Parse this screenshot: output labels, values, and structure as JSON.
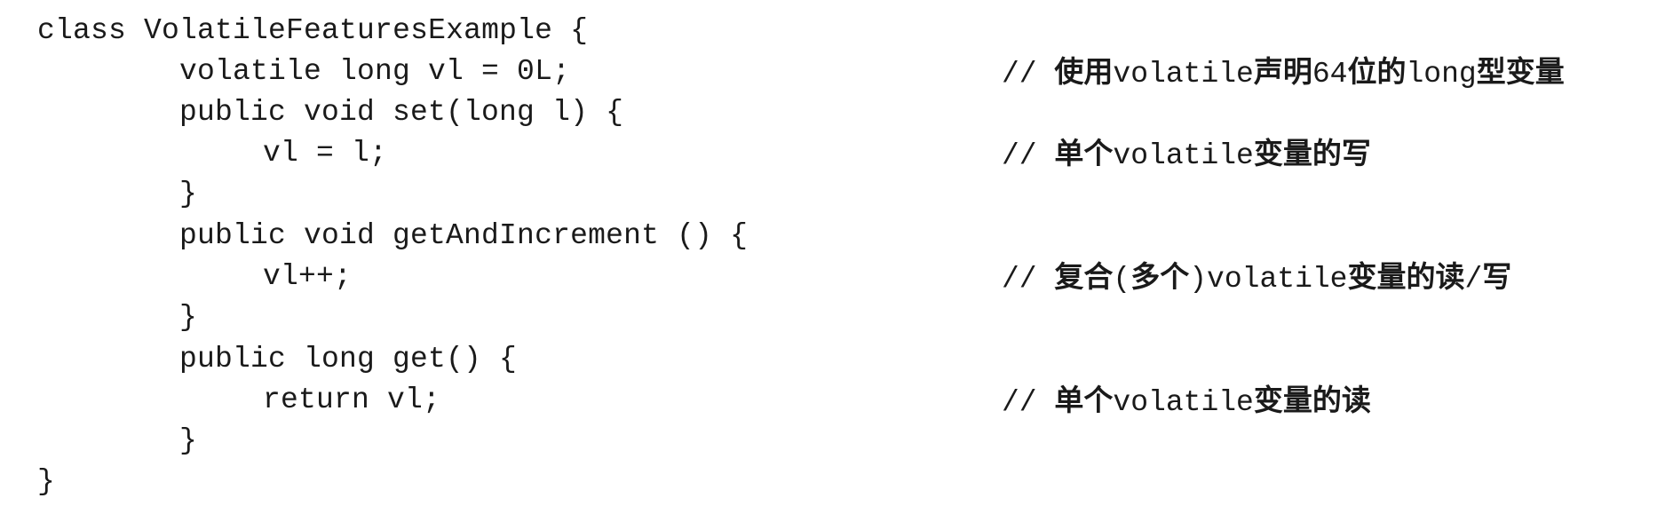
{
  "code": {
    "lines": [
      {
        "text": "class VolatileFeaturesExample {"
      },
      {
        "text": "volatile long vl = 0L;"
      },
      {
        "text": "public void set(long l) {"
      },
      {
        "text": "vl = l;"
      },
      {
        "text": "}"
      },
      {
        "text": "public void getAndIncrement () {"
      },
      {
        "text": "vl++;"
      },
      {
        "text": "}"
      },
      {
        "text": "public long get() {"
      },
      {
        "text": "return vl;"
      },
      {
        "text": "}"
      },
      {
        "text": "}"
      }
    ]
  },
  "comments": {
    "c1": {
      "slash": "// ",
      "p1": "使用",
      "p2": "volatile",
      "p3": "声明",
      "p4": "64",
      "p5": "位的",
      "p6": "long",
      "p7": "型变量"
    },
    "c2": {
      "slash": "// ",
      "p1": "单个",
      "p2": "volatile",
      "p3": "变量的写"
    },
    "c3": {
      "slash": "// ",
      "p1": "复合",
      "p2": "(",
      "p3": "多个",
      "p4": ")",
      "p5": "volatile",
      "p6": "变量的读",
      "p7": "/",
      "p8": "写"
    },
    "c4": {
      "slash": "// ",
      "p1": "单个",
      "p2": "volatile",
      "p3": "变量的读"
    }
  }
}
